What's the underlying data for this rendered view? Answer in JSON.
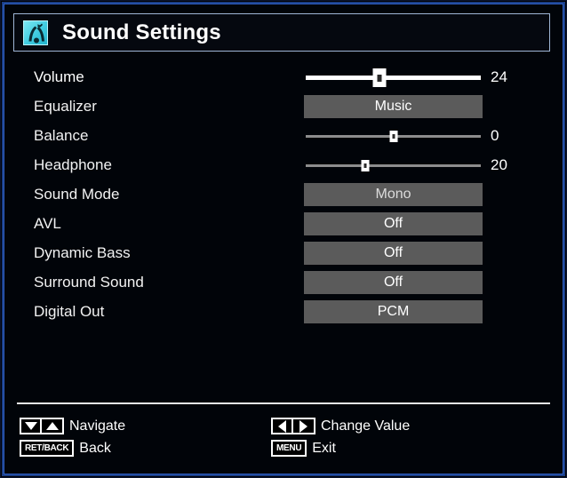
{
  "window": {
    "title": "Sound Settings",
    "icon": "sound-settings-icon",
    "frame_color": "#2f62c9",
    "background": "#010409",
    "title_border": "#9fb6d6",
    "icon_color": "#3fcbe0"
  },
  "menu": {
    "items": [
      {
        "label": "Volume",
        "type": "slider",
        "value": "24",
        "percent": 42,
        "selected": true
      },
      {
        "label": "Equalizer",
        "type": "option",
        "value": "Music",
        "selected": false
      },
      {
        "label": "Balance",
        "type": "slider",
        "value": "0",
        "percent": 50,
        "selected": false
      },
      {
        "label": "Headphone",
        "type": "slider",
        "value": "20",
        "percent": 34,
        "selected": false
      },
      {
        "label": "Sound Mode",
        "type": "option",
        "value": "Mono",
        "selected": false
      },
      {
        "label": "AVL",
        "type": "option",
        "value": "Off",
        "selected": false
      },
      {
        "label": "Dynamic Bass",
        "type": "option",
        "value": "Off",
        "selected": false
      },
      {
        "label": "Surround Sound",
        "type": "option",
        "value": "Off",
        "selected": false
      },
      {
        "label": "Digital Out",
        "type": "option",
        "value": "PCM",
        "selected": false
      }
    ],
    "option_box_color": "#5b5b5b"
  },
  "footer": {
    "navigate": {
      "label": "Navigate",
      "keys": [
        "arrow-down",
        "arrow-up"
      ]
    },
    "back": {
      "label": "Back",
      "key": "RET/BACK"
    },
    "change": {
      "label": "Change Value",
      "keys": [
        "arrow-left",
        "arrow-right"
      ]
    },
    "exit": {
      "label": "Exit",
      "key": "MENU"
    }
  }
}
